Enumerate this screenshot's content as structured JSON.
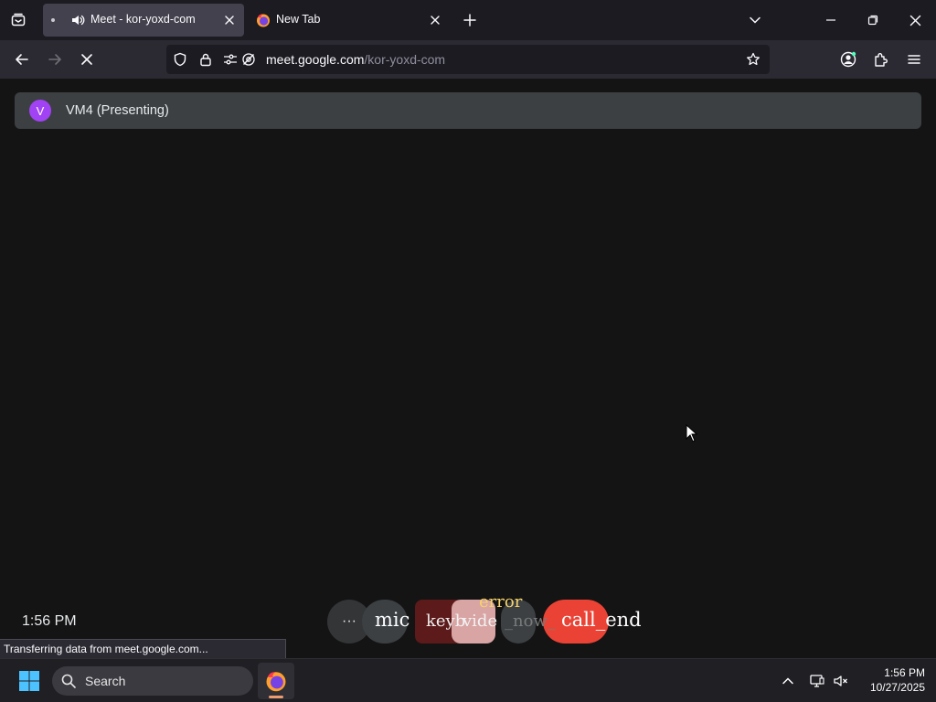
{
  "browser": {
    "tabs": [
      {
        "title": "Meet - kor-yoxd-com",
        "active": true
      },
      {
        "title": "New Tab",
        "active": false
      }
    ],
    "url": {
      "host": "meet.google.com",
      "path": "/kor-yoxd-com"
    },
    "status_text": "Transferring data from meet.google.com..."
  },
  "meet": {
    "presenter_initial": "V",
    "presenter_label": "VM4 (Presenting)",
    "clock": "1:56 PM",
    "controls": {
      "more": "···",
      "mic": "mic",
      "keyboard": "keyb",
      "video": "vide",
      "error": "error",
      "now": "_now_",
      "call_end": "call_end"
    },
    "colors": {
      "avatar": "#a142f4",
      "end_call": "#ea4335",
      "presenter_bar": "#3c4043"
    }
  },
  "taskbar": {
    "search_label": "Search",
    "time": "1:56 PM",
    "date": "10/27/2025"
  }
}
